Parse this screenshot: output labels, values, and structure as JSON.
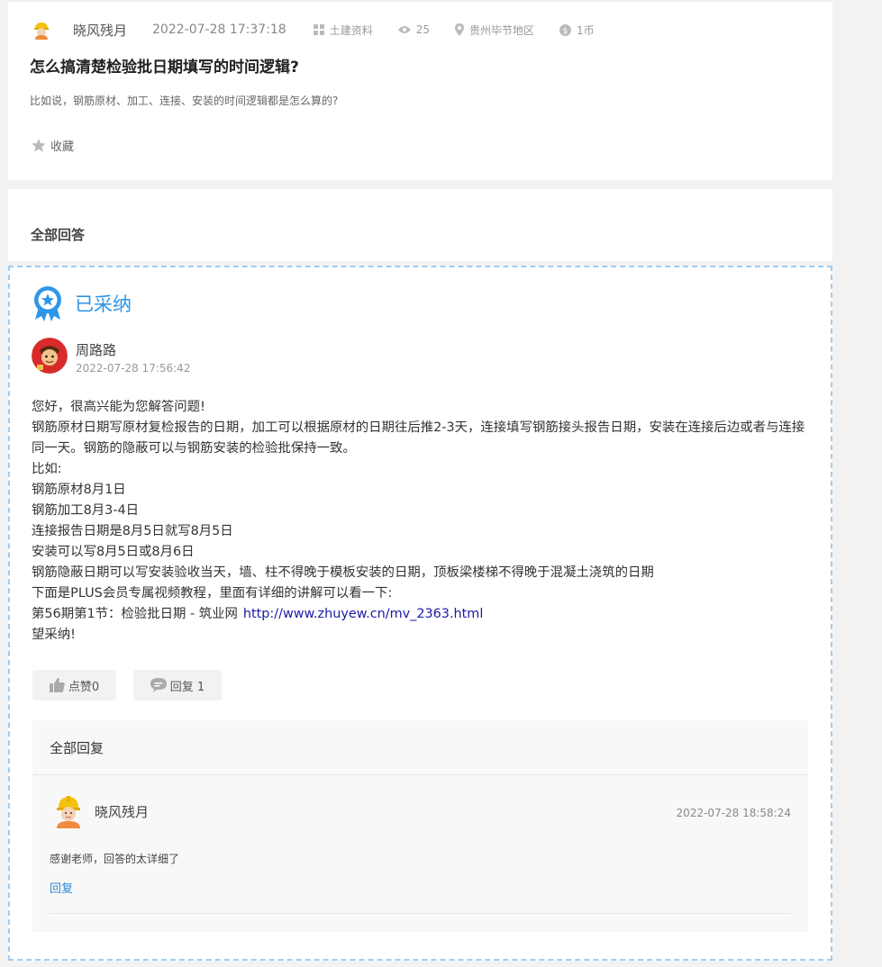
{
  "question": {
    "asker_name": "晓风残月",
    "time": "2022-07-28 17:37:18",
    "category": "土建资料",
    "views": "25",
    "location": "贵州毕节地区",
    "reward": "1币",
    "title": "怎么搞清楚检验批日期填写的时间逻辑?",
    "description": "比如说，钢筋原材、加工、连接、安装的时间逻辑都是怎么算的?",
    "favorite_label": "收藏"
  },
  "answers_section": {
    "title": "全部回答"
  },
  "answer": {
    "badge": "已采纳",
    "author": "周路路",
    "time": "2022-07-28 17:56:42",
    "lines": [
      "您好，很高兴能为您解答问题!",
      "钢筋原材日期写原材复检报告的日期，加工可以根据原材的日期往后推2-3天，连接填写钢筋接头报告日期，安装在连接后边或者与连接同一天。钢筋的隐蔽可以与钢筋安装的检验批保持一致。",
      "比如:",
      "钢筋原材8月1日",
      "钢筋加工8月3-4日",
      "连接报告日期是8月5日就写8月5日",
      "安装可以写8月5日或8月6日",
      "钢筋隐蔽日期可以写安装验收当天，墙、柱不得晚于模板安装的日期，顶板梁楼梯不得晚于混凝土浇筑的日期",
      "下面是PLUS会员专属视频教程，里面有详细的讲解可以看一下:"
    ],
    "link_prefix": "第56期第1节：检验批日期 - 筑业网",
    "link_text": "http://www.zhuyew.cn/mv_2363.html",
    "closing": "望采纳!",
    "like_label": "点赞0",
    "reply_label": "回复 1"
  },
  "replies": {
    "title": "全部回复",
    "items": [
      {
        "name": "晓风残月",
        "time": "2022-07-28 18:58:24",
        "text": "感谢老师，回答的太详细了",
        "action": "回复"
      }
    ]
  },
  "colors": {
    "accent": "#2e96e8",
    "link": "#1a1aa6",
    "badge_border": "#9fcdf2"
  },
  "icons": [
    "worker-avatar",
    "grid-icon",
    "eye-icon",
    "location-pin-icon",
    "coin-icon",
    "star-icon",
    "ribbon-badge-icon",
    "thumb-up-icon",
    "comment-icon"
  ]
}
